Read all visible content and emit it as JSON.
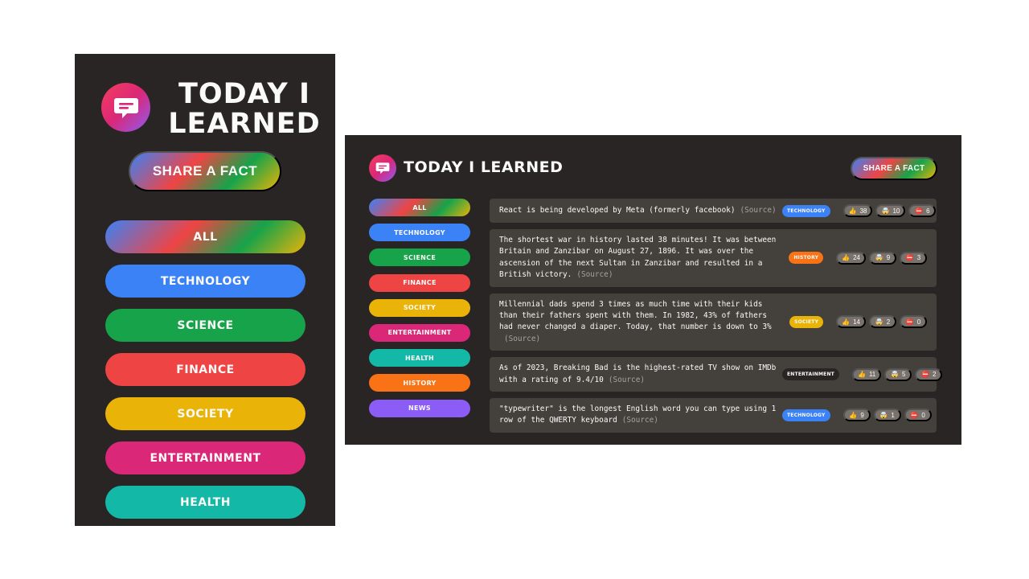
{
  "app": {
    "title": "Today I Learned",
    "share_label": "Share a fact"
  },
  "categories": [
    {
      "name": "All",
      "color": "gradient"
    },
    {
      "name": "technology",
      "color": "#3b82f6"
    },
    {
      "name": "science",
      "color": "#16a34a"
    },
    {
      "name": "finance",
      "color": "#ef4444"
    },
    {
      "name": "society",
      "color": "#eab308"
    },
    {
      "name": "entertainment",
      "color": "#db2777"
    },
    {
      "name": "health",
      "color": "#14b8a6"
    },
    {
      "name": "history",
      "color": "#f97316"
    },
    {
      "name": "news",
      "color": "#8b5cf6"
    }
  ],
  "icons": {
    "logo": "chat-bubble-icon",
    "like": "thumbs-up-icon",
    "mindblown": "mind-blown-icon",
    "false": "no-entry-icon"
  },
  "facts": [
    {
      "text": "React is being developed by Meta (formerly facebook)",
      "source": "(Source)",
      "category": "technology",
      "color": "#3b82f6",
      "votes": {
        "interesting": "38",
        "mindblowing": "10",
        "false": "6"
      }
    },
    {
      "text": "The shortest war in history lasted 38 minutes! It was between Britain and Zanzibar on August 27, 1896. It was over the ascension of the next Sultan in Zanzibar and resulted in a British victory.",
      "source": "(Source)",
      "category": "history",
      "color": "#f97316",
      "votes": {
        "interesting": "24",
        "mindblowing": "9",
        "false": "3"
      }
    },
    {
      "text": "Millennial dads spend 3 times as much time with their kids than their fathers spent with them. In 1982, 43% of fathers had never changed a diaper. Today, that number is down to 3%",
      "source": "(Source)",
      "category": "society",
      "color": "#eab308",
      "votes": {
        "interesting": "14",
        "mindblowing": "2",
        "false": "0"
      }
    },
    {
      "text": "As of 2023, Breaking Bad is the highest-rated TV show on IMDb with a rating of 9.4/10",
      "source": "(Source)",
      "category": "entertainment",
      "color": "#292524",
      "votes": {
        "interesting": "11",
        "mindblowing": "5",
        "false": "2"
      }
    },
    {
      "text": "\"typewriter\" is the longest English word you can type using 1 row of the QWERTY keyboard",
      "source": "(Source)",
      "category": "technology",
      "color": "#3b82f6",
      "votes": {
        "interesting": "9",
        "mindblowing": "1",
        "false": "0"
      }
    }
  ]
}
